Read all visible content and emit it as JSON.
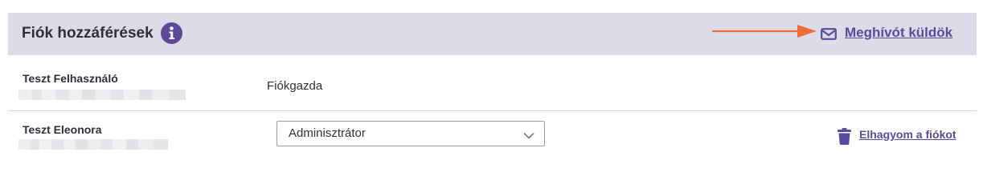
{
  "section": {
    "title": "Fiók hozzáférések",
    "info_icon": "info-icon",
    "invite_label": "Meghívót küldök",
    "invite_icon": "mail-icon",
    "annotation_arrow_color": "#f06a3a",
    "accent_color": "#5b4a99",
    "header_bg": "#dddbe8"
  },
  "accounts": [
    {
      "name": "Teszt Felhasználó",
      "role": "Fiókgazda"
    },
    {
      "name": "Teszt Eleonora",
      "role_select_value": "Adminisztrátor",
      "leave_label": "Elhagyom a fiókot",
      "leave_icon": "trash-icon"
    }
  ]
}
